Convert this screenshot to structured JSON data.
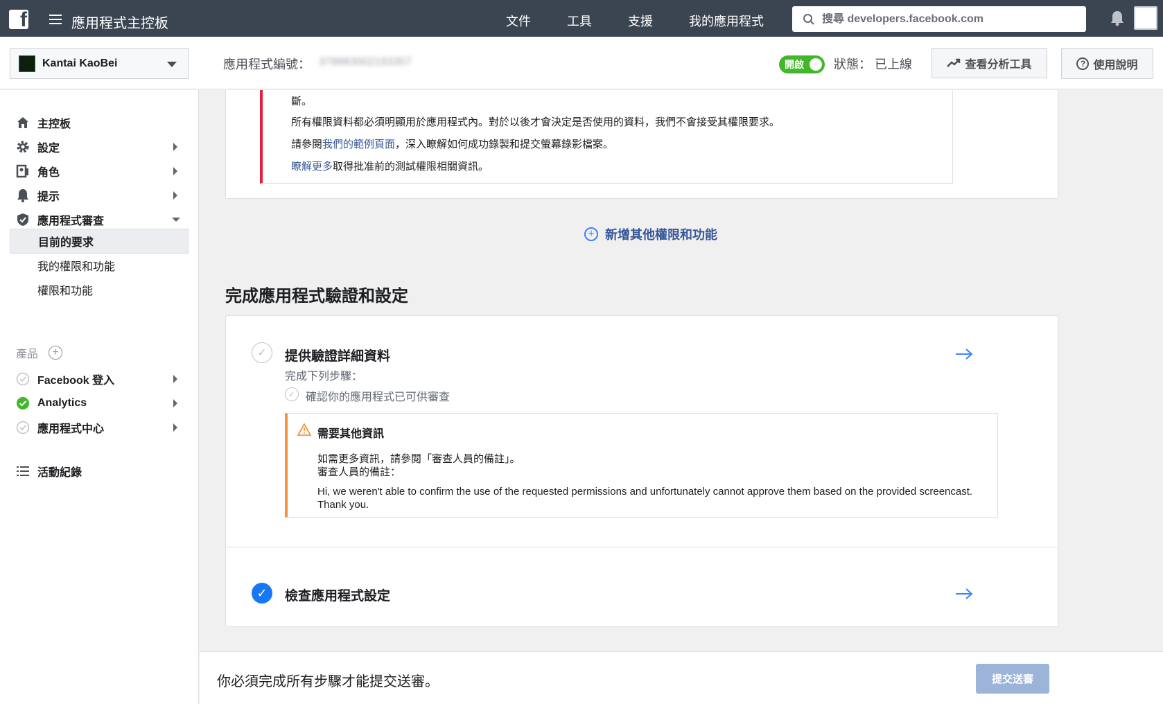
{
  "topbar": {
    "app_title": "應用程式主控板",
    "nav": [
      "文件",
      "工具",
      "支援",
      "我的應用程式"
    ],
    "search_placeholder": "搜尋 developers.facebook.com"
  },
  "subbar": {
    "app_name": "Kantai KaoBei",
    "app_id_label": "應用程式編號：",
    "app_id_value": "378883002193357",
    "toggle_label": "開啟",
    "status_text": "狀態： 已上線",
    "analytics_button": "查看分析工具",
    "help_button": "使用說明"
  },
  "sidebar": {
    "items": [
      {
        "label": "主控板",
        "icon": "home-icon"
      },
      {
        "label": "設定",
        "icon": "gear-icon"
      },
      {
        "label": "角色",
        "icon": "roles-icon"
      },
      {
        "label": "提示",
        "icon": "bell-icon"
      },
      {
        "label": "應用程式審查",
        "icon": "shield-icon"
      }
    ],
    "sub_items": [
      "目前的要求",
      "我的權限和功能",
      "權限和功能"
    ],
    "products_label": "產品",
    "products": [
      {
        "label": "Facebook 登入",
        "status": "pending"
      },
      {
        "label": "Analytics",
        "status": "done"
      },
      {
        "label": "應用程式中心",
        "status": "pending"
      }
    ],
    "activity_log": "活動紀錄"
  },
  "notice": {
    "line1": "斷。",
    "line2": "所有權限資料都必須明顯用於應用程式內。對於以後才會決定是否使用的資料，我們不會接受其權限要求。",
    "line3_prefix": "請參閱",
    "line3_link": "我們的範例頁面",
    "line3_suffix": "，深入瞭解如何成功錄製和提交螢幕錄影檔案。",
    "line4_link": "瞭解更多",
    "line4_suffix": "取得批准前的測試權限相關資訊。"
  },
  "add_more": "新增其他權限和功能",
  "section_title": "完成應用程式驗證和設定",
  "steps": {
    "step1_title": "提供驗證詳細資料",
    "step1_sub": "完成下列步驟：",
    "step1_check": "確認你的應用程式已可供審查",
    "warn_title": "需要其他資訊",
    "warn_line1": "如需更多資訊，請參閱「審查人員的備註」。",
    "warn_line2": "審查人員的備註：",
    "warn_note": "Hi, we weren't able to confirm the use of the requested permissions and unfortunately cannot approve them based on the provided screencast. Thank you.",
    "step2_title": "檢查應用程式設定"
  },
  "footer": {
    "message": "你必須完成所有步驟才能提交送審。",
    "submit": "提交送審"
  },
  "colors": {
    "topbar": "#3b4451",
    "toggle_on": "#42b72a",
    "notice_border": "#e41e3f",
    "warn_border": "#f7923b",
    "link": "#365899",
    "done_check": "#1877f2",
    "submit_disabled": "#9cb4d8"
  }
}
